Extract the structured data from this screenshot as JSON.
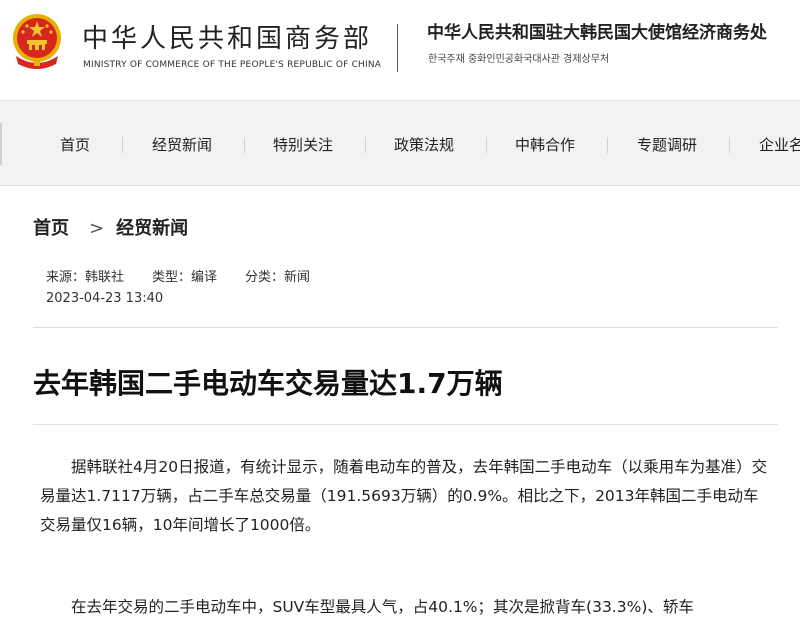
{
  "header": {
    "ministry_cn": "中华人民共和国商务部",
    "ministry_en": "MINISTRY OF COMMERCE OF THE PEOPLE'S REPUBLIC OF CHINA",
    "embassy_cn": "中华人民共和国驻大韩民国大使馆经济商务处",
    "embassy_kr": "한국주재 중화인민공화국대사관 경제상무처",
    "emblem_icon": "national-emblem-icon",
    "emblem_colors": {
      "red": "#d7261e",
      "gold": "#e9b000"
    }
  },
  "nav": {
    "items": [
      {
        "label": "首页"
      },
      {
        "label": "经贸新闻"
      },
      {
        "label": "特别关注"
      },
      {
        "label": "政策法规"
      },
      {
        "label": "中韩合作"
      },
      {
        "label": "专题调研"
      },
      {
        "label": "企业名"
      }
    ]
  },
  "breadcrumb": {
    "home": "首页",
    "separator": ">",
    "current": "经贸新闻"
  },
  "meta": {
    "source": "来源：韩联社",
    "type": "类型：编译",
    "category": "分类：新闻",
    "date": "2023-04-23 13:40"
  },
  "article": {
    "title": "去年韩国二手电动车交易量达1.7万辆",
    "paragraphs": [
      "据韩联社4月20日报道，有统计显示，随着电动车的普及，去年韩国二手电动车（以乘用车为基准）交易量达1.7117万辆，占二手车总交易量（191.5693万辆）的0.9%。相比之下，2013年韩国二手电动车交易量仅16辆，10年间增长了1000倍。",
      "在去年交易的二手电动车中，SUV车型最具人气，占40.1%；其次是掀背车(33.3%)、轿车"
    ]
  }
}
